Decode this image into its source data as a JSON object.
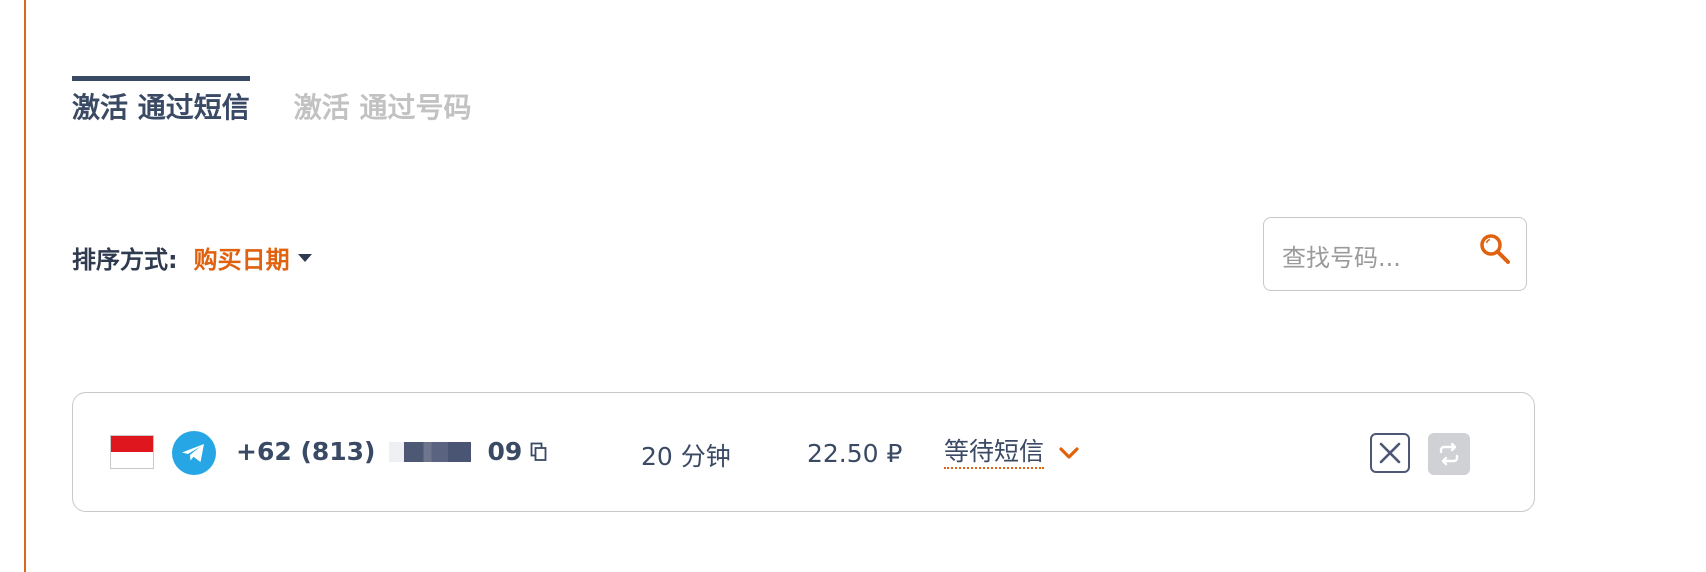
{
  "tabs": [
    {
      "label": "激活 通过短信",
      "active": true
    },
    {
      "label": "激活 通过号码",
      "active": false
    }
  ],
  "sort": {
    "label": "排序方式:",
    "value": "购买日期"
  },
  "search": {
    "placeholder": "查找号码..."
  },
  "row": {
    "country_flag": "indonesia-flag",
    "service_icon": "telegram-icon",
    "phone_prefix": "+62 (813)",
    "phone_suffix": "09",
    "duration": "20 分钟",
    "price": "22.50 ₽",
    "status": "等待短信"
  },
  "colors": {
    "accent": "#e0620f",
    "text": "#3a4a64",
    "inactive_tab": "#c2c2c2",
    "telegram": "#27a6e5"
  }
}
